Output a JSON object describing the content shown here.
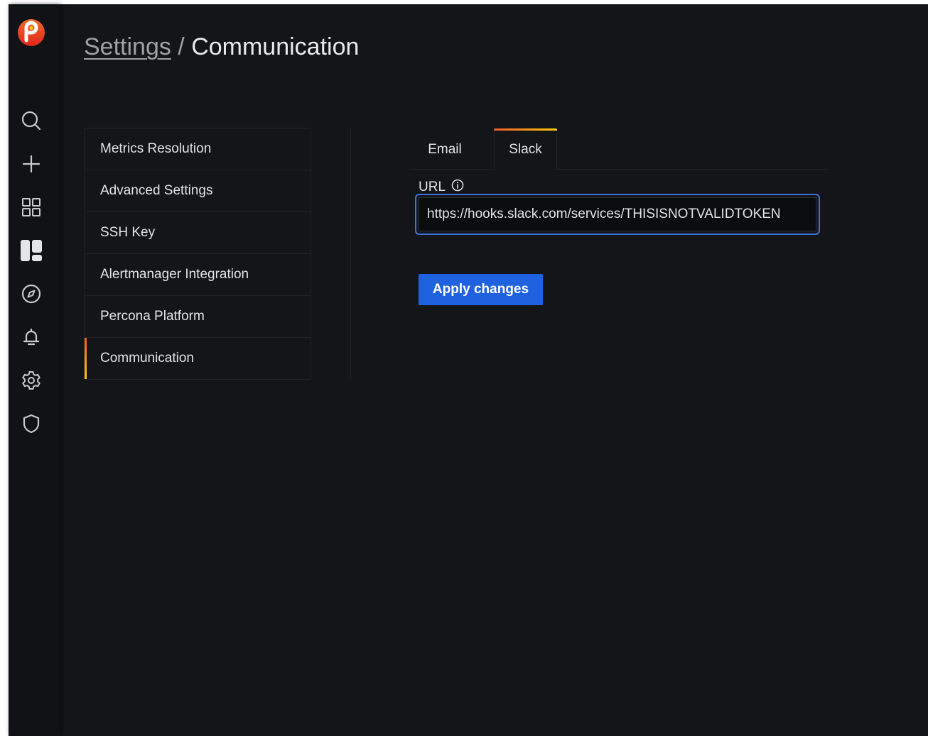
{
  "sidebar": {
    "logo": "percona-logo",
    "items": [
      {
        "icon": "search-icon"
      },
      {
        "icon": "plus-icon"
      },
      {
        "icon": "dashboards-icon"
      },
      {
        "icon": "pmm-dashboard-icon"
      },
      {
        "icon": "explore-icon"
      },
      {
        "icon": "alerting-bell-icon"
      },
      {
        "icon": "gear-icon"
      },
      {
        "icon": "shield-icon"
      }
    ]
  },
  "breadcrumb": {
    "parent": "Settings",
    "separator": " / ",
    "current": "Communication"
  },
  "settings_nav": {
    "items": [
      {
        "label": "Metrics Resolution",
        "active": false
      },
      {
        "label": "Advanced Settings",
        "active": false
      },
      {
        "label": "SSH Key",
        "active": false
      },
      {
        "label": "Alertmanager Integration",
        "active": false
      },
      {
        "label": "Percona Platform",
        "active": false
      },
      {
        "label": "Communication",
        "active": true
      }
    ]
  },
  "tabs": [
    {
      "label": "Email",
      "active": false
    },
    {
      "label": "Slack",
      "active": true
    }
  ],
  "form": {
    "url_label": "URL",
    "url_value": "https://hooks.slack.com/services/THISISNOTVALIDTOKEN",
    "apply_label": "Apply changes"
  },
  "colors": {
    "background": "#141519",
    "sidebar": "#111216",
    "accent_gradient_start": "#f05a28",
    "accent_gradient_end": "#fbca0a",
    "primary_button": "#1f62e0",
    "focus_border": "#3d71d9"
  }
}
